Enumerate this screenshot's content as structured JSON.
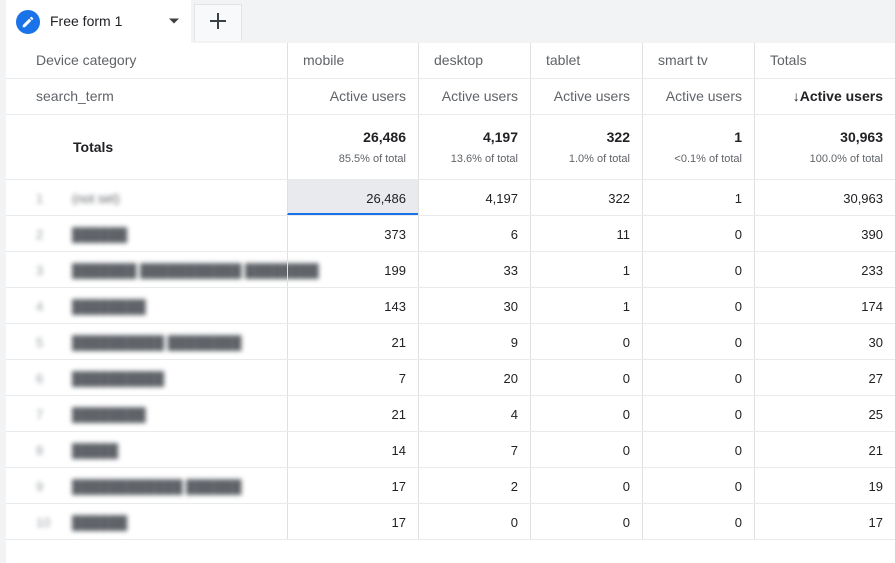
{
  "tab": {
    "title": "Free form 1",
    "icon": "pencil-icon",
    "add_icon": "plus-icon"
  },
  "accent": "#1a73e8",
  "header": {
    "dimension_label": "Device category",
    "columns": [
      "mobile",
      "desktop",
      "tablet",
      "smart tv",
      "Totals"
    ]
  },
  "subheader": {
    "dimension_label": "search_term",
    "metrics": [
      "Active users",
      "Active users",
      "Active users",
      "Active users",
      "Active users"
    ],
    "sorted_indicator": "↓"
  },
  "totals": {
    "label": "Totals",
    "values": [
      "26,486",
      "4,197",
      "322",
      "1",
      "30,963"
    ],
    "percents": [
      "85.5% of total",
      "13.6% of total",
      "1.0% of total",
      "<0.1% of total",
      "100.0% of total"
    ]
  },
  "rows": [
    {
      "index": "1",
      "term": "(not set)",
      "values": [
        "26,486",
        "4,197",
        "322",
        "1",
        "30,963"
      ]
    },
    {
      "index": "2",
      "term": "██████",
      "values": [
        "373",
        "6",
        "11",
        "0",
        "390"
      ]
    },
    {
      "index": "3",
      "term": "███████ ███████████ ████████",
      "values": [
        "199",
        "33",
        "1",
        "0",
        "233"
      ]
    },
    {
      "index": "4",
      "term": "████████",
      "values": [
        "143",
        "30",
        "1",
        "0",
        "174"
      ]
    },
    {
      "index": "5",
      "term": "██████████ ████████",
      "values": [
        "21",
        "9",
        "0",
        "0",
        "30"
      ]
    },
    {
      "index": "6",
      "term": "██████████",
      "values": [
        "7",
        "20",
        "0",
        "0",
        "27"
      ]
    },
    {
      "index": "7",
      "term": "████████",
      "values": [
        "21",
        "4",
        "0",
        "0",
        "25"
      ]
    },
    {
      "index": "8",
      "term": "█████",
      "values": [
        "14",
        "7",
        "0",
        "0",
        "21"
      ]
    },
    {
      "index": "9",
      "term": "████████████ ██████",
      "values": [
        "17",
        "2",
        "0",
        "0",
        "19"
      ]
    },
    {
      "index": "10",
      "term": "██████",
      "values": [
        "17",
        "0",
        "0",
        "0",
        "17"
      ]
    }
  ]
}
